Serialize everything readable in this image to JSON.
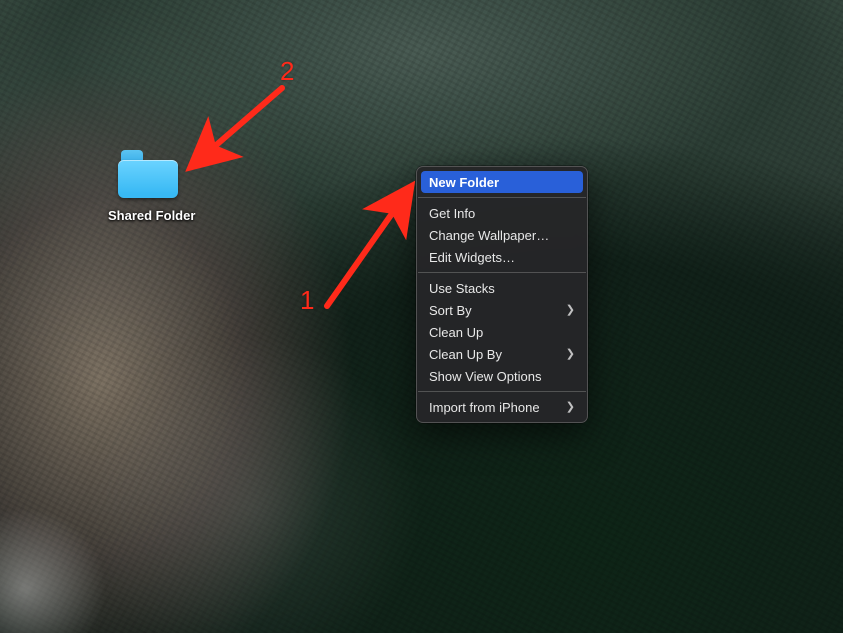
{
  "desktop": {
    "folder_label": "Shared Folder"
  },
  "context_menu": {
    "new_folder": "New Folder",
    "get_info": "Get Info",
    "change_wallpaper": "Change Wallpaper…",
    "edit_widgets": "Edit Widgets…",
    "use_stacks": "Use Stacks",
    "sort_by": "Sort By",
    "clean_up": "Clean Up",
    "clean_up_by": "Clean Up By",
    "show_view_options": "Show View Options",
    "import_from_iphone": "Import from iPhone"
  },
  "annotations": {
    "label1": "1",
    "label2": "2",
    "arrow_color": "#ff2a1a"
  }
}
